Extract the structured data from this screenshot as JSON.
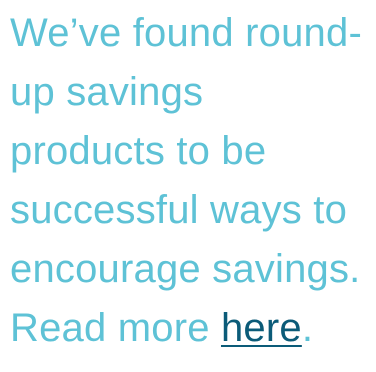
{
  "content": {
    "lines": [
      "We’ve found round-",
      "up savings",
      "products to be",
      "successful ways to",
      "encourage savings."
    ],
    "last_line": {
      "prefix": "Read more ",
      "link_text": "here",
      "suffix": "."
    }
  },
  "colors": {
    "text": "#5ec2d6",
    "link": "#0b5b78",
    "background": "#ffffff"
  }
}
